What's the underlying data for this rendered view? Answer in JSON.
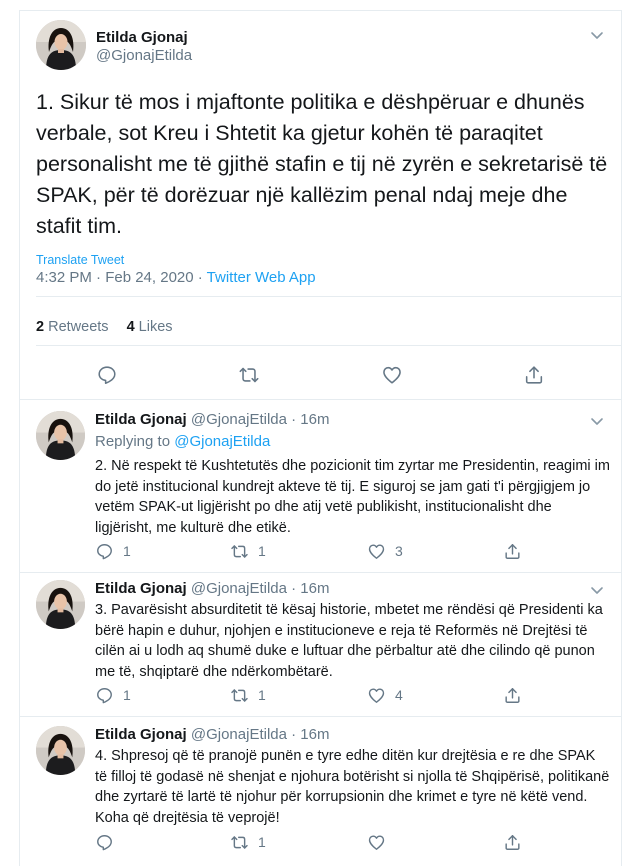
{
  "main_tweet": {
    "author_name": "Etilda Gjonaj",
    "author_handle": "@GjonajEtilda",
    "text": "1. Sikur të mos i mjaftonte politika e dëshpëruar e dhunës verbale, sot Kreu i Shtetit ka gjetur kohën të paraqitet personalisht me të gjithë stafin e tij në zyrën e sekretarisë të SPAK, për të dorëzuar një kallëzim penal ndaj meje dhe stafit tim.",
    "translate_label": "Translate Tweet",
    "timestamp": "4:32 PM · Feb 24, 2020 · ",
    "source": "Twitter Web App",
    "retweets_count": "2",
    "retweets_label": "Retweets",
    "likes_count": "4",
    "likes_label": "Likes",
    "icons": [
      "chevron-down-icon",
      "reply-icon",
      "retweet-icon",
      "like-icon",
      "share-icon"
    ]
  },
  "replies": [
    {
      "author_name": "Etilda Gjonaj",
      "author_handle": "@GjonajEtilda · 16m",
      "replying_label": "Replying to ",
      "replying_to": "@GjonajEtilda",
      "text": "2. Në respekt të Kushtetutës dhe pozicionit tim zyrtar me Presidentin, reagimi im do jetë institucional kundrejt akteve të tij. E siguroj se jam gati t'i përgjigjem jo vetëm SPAK-ut ligjërisht po dhe atij vetë publikisht, institucionalisht dhe ligjërisht, me kulturë dhe etikë.",
      "reply_count": "1",
      "retweet_count": "1",
      "like_count": "3"
    },
    {
      "author_name": "Etilda Gjonaj",
      "author_handle": "@GjonajEtilda · 16m",
      "text": "3. Pavarësisht absurditetit të kësaj historie, mbetet me rëndësi që Presidenti ka bërë hapin e duhur, njohjen e institucioneve e reja të Reformës në Drejtësi të cilën ai u lodh aq shumë duke e luftuar dhe përbaltur atë dhe cilindo që punon me të, shqiptarë dhe ndërkombëtarë.",
      "reply_count": "1",
      "retweet_count": "1",
      "like_count": "4"
    },
    {
      "author_name": "Etilda Gjonaj",
      "author_handle": "@GjonajEtilda · 16m",
      "text": "4. Shpresoj që të pranojë punën e tyre edhe ditën kur drejtësia e re dhe SPAK të filloj të godasë në shenjat e njohura botërisht si njolla të Shqipërisë, politikanë dhe zyrtarë të lartë të njohur për korrupsionin dhe krimet e tyre në këtë vend. Koha që drejtësia të veprojë!",
      "reply_count": "",
      "retweet_count": "1",
      "like_count": ""
    }
  ],
  "colors": {
    "text": "#14171a",
    "secondary": "#657786",
    "link": "#1da1f2",
    "border": "#e6ecf0"
  }
}
